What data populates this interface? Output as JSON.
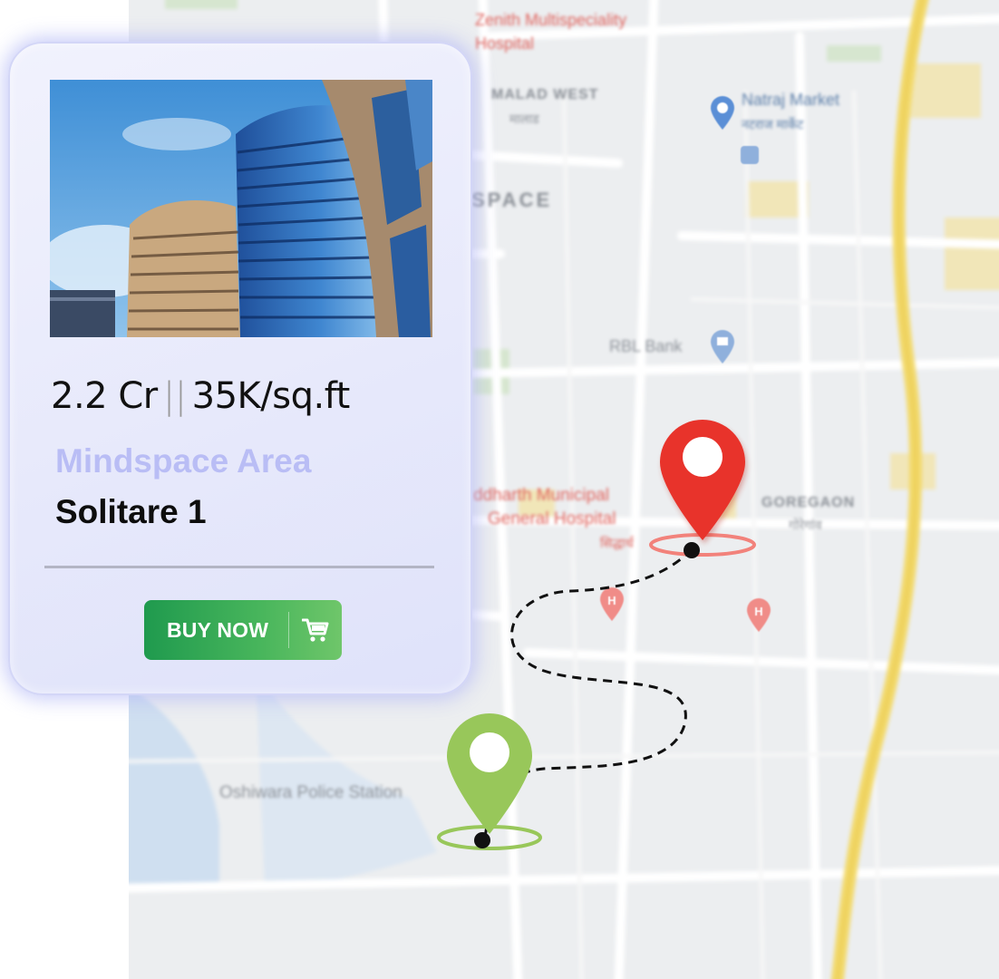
{
  "map": {
    "labels": {
      "zenith": "Zenith Multispeciality",
      "zenith2": "Hospital",
      "malad_west": "MALAD WEST",
      "malad_west_local": "मालाड",
      "mindspace": "SPACE",
      "natraj": "Natraj Market",
      "natraj_local": "नटराज मार्केट",
      "rbl": "RBL Bank",
      "siddharth": "ddharth Municipal",
      "siddharth2": "General Hospital",
      "siddharth_local": "सिद्धार्थ",
      "goregaon": "GOREGAON",
      "goregaon_local": "गोरेगांव",
      "oshiwara": "Oshiwara Police Station"
    },
    "colors": {
      "hospital": "#e8615c",
      "bank": "#5b8fd6",
      "road_major": "#f2d96b"
    }
  },
  "card": {
    "price": "2.2 Cr",
    "price_separator": "||",
    "rate": "35K/sq.ft",
    "area": "Mindspace Area",
    "name": "Solitare 1",
    "buy_label": "BUY NOW",
    "cart_icon": "cart-icon"
  },
  "pins": {
    "destination_color": "#e8332b",
    "origin_color": "#98c75a"
  }
}
